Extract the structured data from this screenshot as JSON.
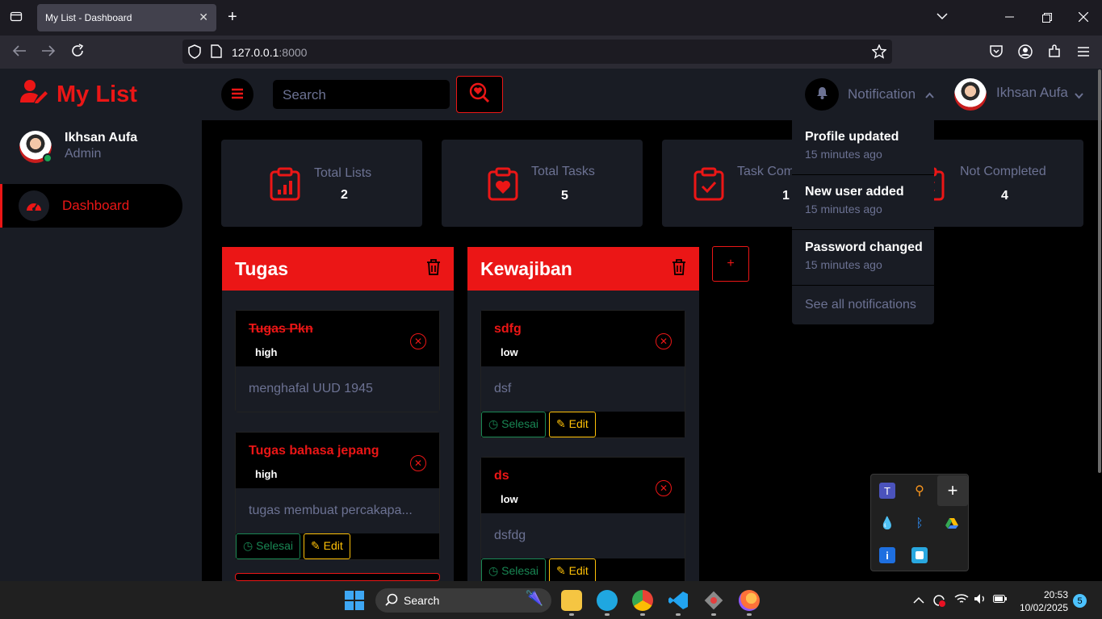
{
  "browser": {
    "tab_title": "My List - Dashboard",
    "tab_close": "✕",
    "new_tab": "+",
    "url_host": "127.0.0.1",
    "url_port": ":8000"
  },
  "brand": {
    "name": "My List"
  },
  "sidebar": {
    "user_name": "Ikhsan Aufa",
    "user_role": "Admin",
    "items": [
      {
        "label": "Dashboard"
      }
    ]
  },
  "topbar": {
    "search_placeholder": "Search",
    "notification_label": "Notification",
    "user_name": "Ikhsan Aufa"
  },
  "stats": [
    {
      "label": "Total Lists",
      "value": "2"
    },
    {
      "label": "Total Tasks",
      "value": "5"
    },
    {
      "label": "Task Com",
      "value": "1"
    },
    {
      "label": "Not Completed",
      "value": "4"
    }
  ],
  "notifications": {
    "items": [
      {
        "title": "Profile updated",
        "time": "15 minutes ago"
      },
      {
        "title": "New user added",
        "time": "15 minutes ago"
      },
      {
        "title": "Password changed",
        "time": "15 minutes ago"
      }
    ],
    "see_all": "See all notifications"
  },
  "lists": [
    {
      "title": "Tugas",
      "tasks": [
        {
          "title": "Tugas Pkn",
          "priority": "high",
          "desc": "menghafal UUD 1945",
          "done": true
        },
        {
          "title": "Tugas bahasa jepang",
          "priority": "high",
          "desc": "tugas membuat percakapa...",
          "done": false,
          "done_label": "Selesai",
          "edit_label": "Edit"
        }
      ]
    },
    {
      "title": "Kewajiban",
      "tasks": [
        {
          "title": "sdfg",
          "priority": "low",
          "desc": "dsf",
          "done": false,
          "done_label": "Selesai",
          "edit_label": "Edit"
        },
        {
          "title": "ds",
          "priority": "low",
          "desc": "dsfdg",
          "done": false,
          "done_label": "Selesai",
          "edit_label": "Edit"
        }
      ]
    }
  ],
  "add_list_label": "+",
  "taskbar": {
    "search_label": "Search",
    "time": "20:53",
    "date": "10/02/2025",
    "badge": "5"
  },
  "colors": {
    "accent": "#eb1616",
    "panel": "#191c24",
    "muted": "#6c7293",
    "success": "#198754",
    "warning": "#ffc107"
  }
}
